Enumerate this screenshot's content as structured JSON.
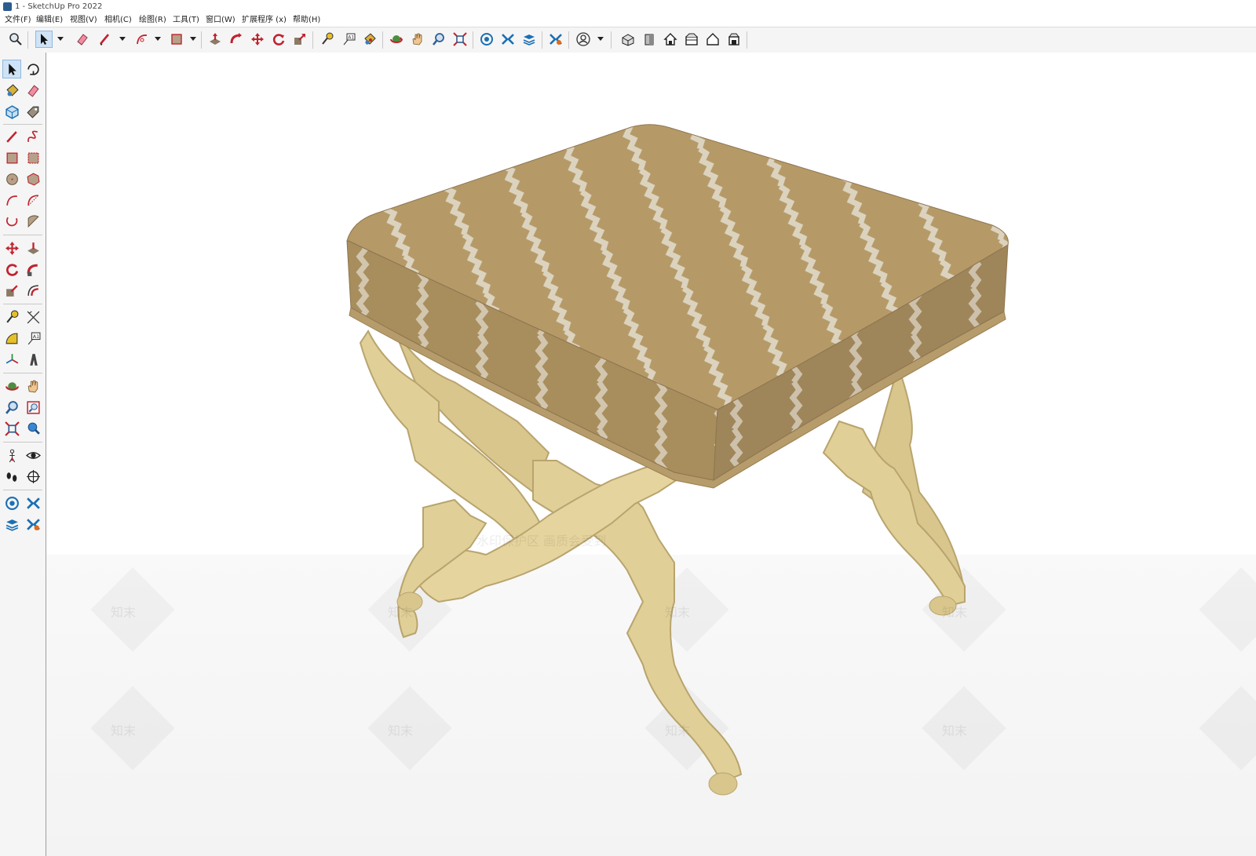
{
  "window": {
    "title": "1 - SketchUp Pro 2022"
  },
  "menu": {
    "items": [
      "文件(F)",
      "编辑(E)",
      "视图(V)",
      "相机(C)",
      "绘图(R)",
      "工具(T)",
      "窗口(W)",
      "扩展程序 (x)",
      "帮助(H)"
    ]
  },
  "toolbar": {
    "tools": [
      {
        "name": "zoom-extents-icon"
      },
      {
        "name": "select-icon",
        "active": true
      },
      {
        "name": "eraser-icon"
      },
      {
        "name": "line-icon"
      },
      {
        "name": "arc-icon"
      },
      {
        "name": "rectangle-icon"
      },
      {
        "name": "push-pull-icon"
      },
      {
        "name": "follow-me-icon"
      },
      {
        "name": "move-icon"
      },
      {
        "name": "rotate-icon"
      },
      {
        "name": "scale-icon"
      },
      {
        "name": "tape-measure-icon"
      },
      {
        "name": "text-icon"
      },
      {
        "name": "paint-bucket-icon"
      },
      {
        "name": "orbit-icon"
      },
      {
        "name": "pan-icon"
      },
      {
        "name": "zoom-icon"
      },
      {
        "name": "zoom-extents-icon"
      },
      {
        "name": "warehouse-icon"
      },
      {
        "name": "extensions-icon"
      },
      {
        "name": "layout-icon"
      },
      {
        "name": "extension-manager-icon"
      },
      {
        "name": "account-icon"
      },
      {
        "name": "view-iso-icon"
      },
      {
        "name": "view-front-icon"
      },
      {
        "name": "view-home-icon"
      },
      {
        "name": "view-top-icon"
      },
      {
        "name": "view-house-icon"
      },
      {
        "name": "view-back-icon"
      }
    ]
  },
  "left_toolbar": {
    "tools": [
      "select-icon",
      "orbit-icon",
      "paint-bucket-icon",
      "eraser-icon",
      "component-icon",
      "tag-icon",
      "line-icon",
      "freehand-icon",
      "rectangle-icon",
      "rotated-rectangle-icon",
      "circle-icon",
      "polygon-icon",
      "arc-icon",
      "two-point-arc-icon",
      "three-point-arc-icon",
      "pie-icon",
      "move-icon",
      "push-pull-icon",
      "rotate-icon",
      "follow-me-icon",
      "scale-icon",
      "offset-icon",
      "tape-measure-icon",
      "dimension-icon",
      "protractor-icon",
      "text-icon",
      "axes-icon",
      "3d-text-icon",
      "orbit-icon",
      "pan-icon",
      "zoom-icon",
      "zoom-window-icon",
      "zoom-extents-icon",
      "previous-view-icon",
      "position-camera-icon",
      "look-around-icon",
      "walk-icon",
      "section-plane-icon",
      "warehouse-icon",
      "extensions-icon",
      "layout-icon",
      "extension-manager-icon"
    ]
  },
  "viewport": {
    "model": "upholstered-x-bench",
    "colors": {
      "fabric": "#b59a68",
      "fabric_dark": "#9a7f52",
      "stripe": "#e3ddcf",
      "wood": "#e1cf98",
      "wood_dark": "#b8a46e"
    },
    "watermark_text": "水印保护区  画质会受到",
    "watermark_logo": "知末"
  }
}
